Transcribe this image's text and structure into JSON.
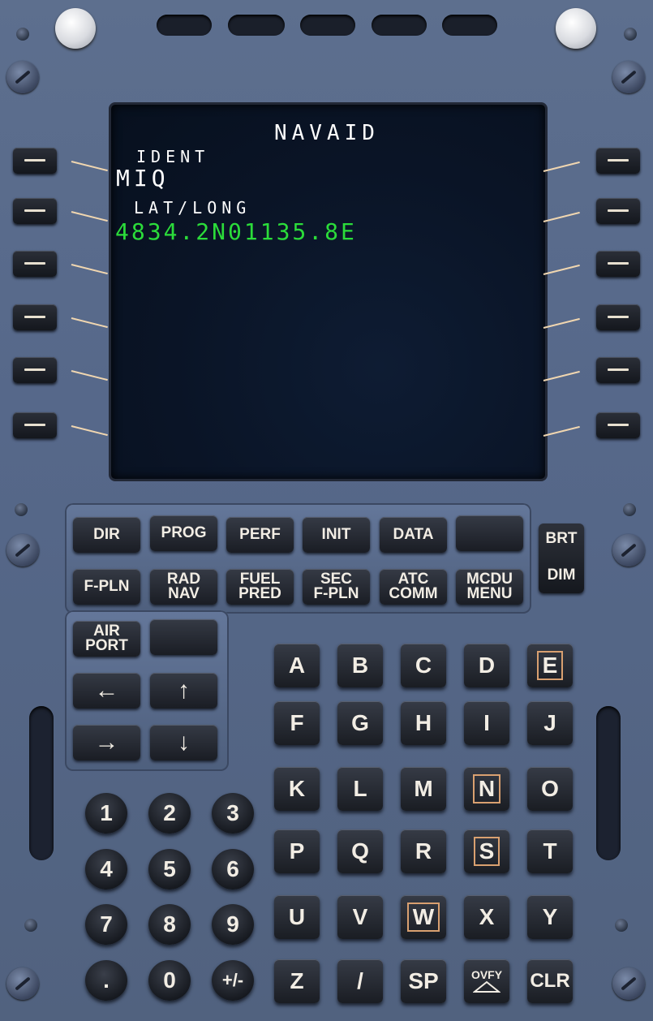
{
  "screen": {
    "title": "NAVAID",
    "l1_label": "IDENT",
    "l1_value": "MIQ",
    "l2_label": "LAT/LONG",
    "l2_value": "4834.2N01135.8E",
    "text_color": "#ffffff",
    "value_color": "#2bdc3a"
  },
  "function_keys": {
    "dir": "DIR",
    "prog": "PROG",
    "perf": "PERF",
    "init": "INIT",
    "data": "DATA",
    "blank1": "",
    "fpln": "F-PLN",
    "radnav": "RAD\nNAV",
    "fuelpred": "FUEL\nPRED",
    "secfpln": "SEC\nF-PLN",
    "atccomm": "ATC\nCOMM",
    "mcdumenu": "MCDU\nMENU",
    "airport": "AIR\nPORT",
    "blank2": ""
  },
  "brightness": {
    "brt": "BRT",
    "dim": "DIM"
  },
  "arrows": {
    "left": "←",
    "up": "↑",
    "right": "→",
    "down": "↓"
  },
  "letters": [
    "A",
    "B",
    "C",
    "D",
    "E",
    "F",
    "G",
    "H",
    "I",
    "J",
    "K",
    "L",
    "M",
    "N",
    "O",
    "P",
    "Q",
    "R",
    "S",
    "T",
    "U",
    "V",
    "W",
    "X",
    "Y"
  ],
  "bottom_keys": {
    "z": "Z",
    "slash": "/",
    "sp": "SP",
    "ovfy": "OVFY",
    "clr": "CLR"
  },
  "numbers": [
    "1",
    "2",
    "3",
    "4",
    "5",
    "6",
    "7",
    "8",
    "9",
    ".",
    "0",
    "+/-"
  ],
  "colors": {
    "panel": "#56688a",
    "accent_box": "#d9a070",
    "key_text": "#f2ede4"
  }
}
